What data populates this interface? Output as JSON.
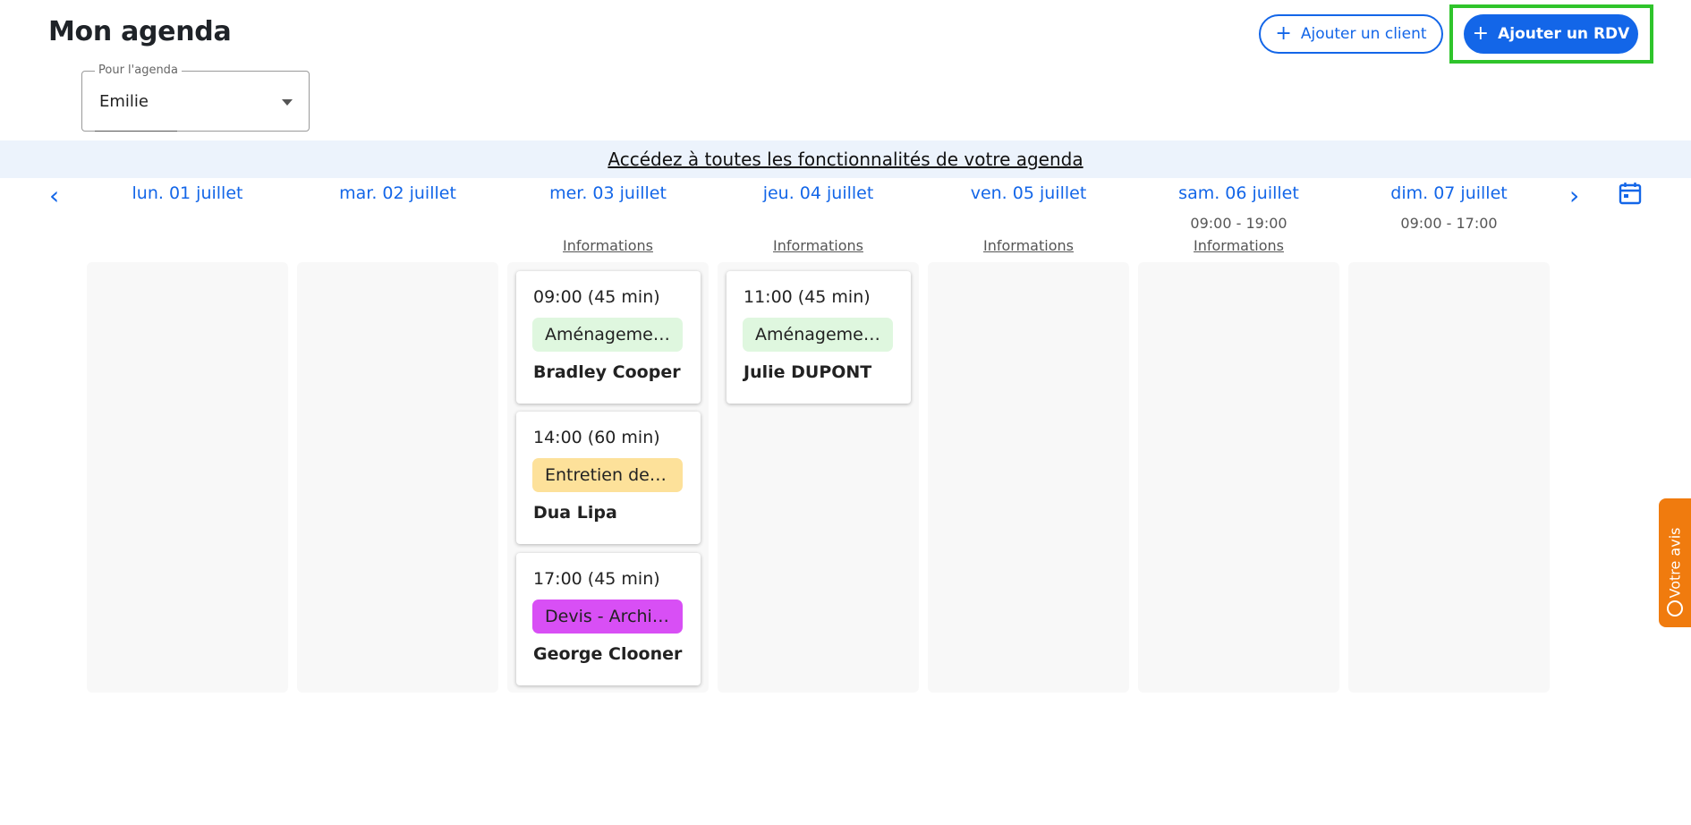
{
  "header": {
    "title": "Mon agenda",
    "add_client_label": "Ajouter un client",
    "add_appointment_label": "Ajouter un RDV",
    "plus_icon": "plus-icon"
  },
  "agenda_select": {
    "label": "Pour l'agenda",
    "value": "Emilie"
  },
  "banner": {
    "link_text": "Accédez à toutes les fonctionnalités de votre agenda"
  },
  "days": [
    {
      "label": "lun. 01 juillet",
      "hours": "",
      "info": ""
    },
    {
      "label": "mar. 02 juillet",
      "hours": "",
      "info": ""
    },
    {
      "label": "mer. 03 juillet",
      "hours": "",
      "info": "Informations"
    },
    {
      "label": "jeu. 04 juillet",
      "hours": "",
      "info": "Informations"
    },
    {
      "label": "ven. 05 juillet",
      "hours": "",
      "info": "Informations"
    },
    {
      "label": "sam. 06 juillet",
      "hours": "09:00 - 19:00",
      "info": "Informations"
    },
    {
      "label": "dim. 07 juillet",
      "hours": "09:00 - 17:00",
      "info": ""
    }
  ],
  "appointments": [
    {
      "time": "09:00 (45 min)",
      "service": "Aménagement",
      "client": "Bradley Cooper",
      "color": "#dff7df"
    },
    {
      "time": "14:00 (60 min)",
      "service": "Entretien de jardin",
      "client": "Dua Lipa",
      "color": "#fde19a"
    },
    {
      "time": "17:00 (45 min)",
      "service": "Devis - Architecte",
      "client": "George Clooner",
      "color": "#d84ff5"
    },
    {
      "time": "11:00 (45 min)",
      "service": "Aménagement",
      "client": "Julie DUPONT",
      "color": "#dff7df"
    }
  ],
  "feedback": {
    "label": "Votre avis"
  },
  "colors": {
    "primary": "#1366e8",
    "banner_bg": "#ecf3fc",
    "feedback": "#f07b0e",
    "highlight": "#2fc42b"
  }
}
